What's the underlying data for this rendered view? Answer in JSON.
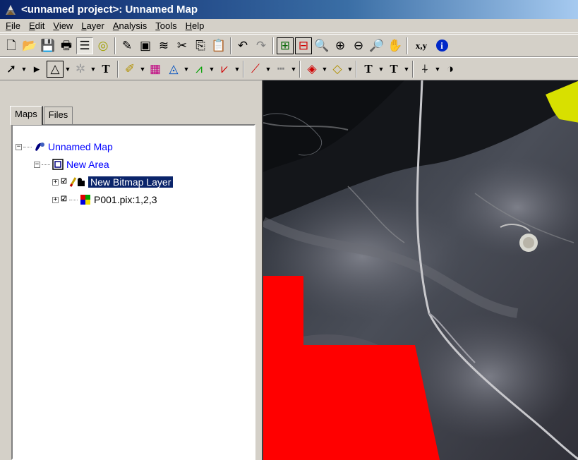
{
  "window": {
    "title": "<unnamed project>: Unnamed Map"
  },
  "menu": [
    "File",
    "Edit",
    "View",
    "Layer",
    "Analysis",
    "Tools",
    "Help"
  ],
  "toolbar1": {
    "xy_label": "x,y",
    "info_label": "i"
  },
  "toolbar2": {
    "text_label_1": "T",
    "text_label_2": "T",
    "text_label_3": "T",
    "text_label_4": "T"
  },
  "panel": {
    "tabs": [
      "Maps",
      "Files"
    ],
    "tree": {
      "map": "Unnamed Map",
      "area": "New Area",
      "layers": [
        {
          "label": "New Bitmap Layer",
          "selected": true
        },
        {
          "label": "P001.pix:1,2,3",
          "selected": false
        }
      ]
    }
  },
  "colors": {
    "selection": "#0a246a",
    "bitmap_fill": "#ff0000",
    "highlight_vector": "#d8e000"
  }
}
